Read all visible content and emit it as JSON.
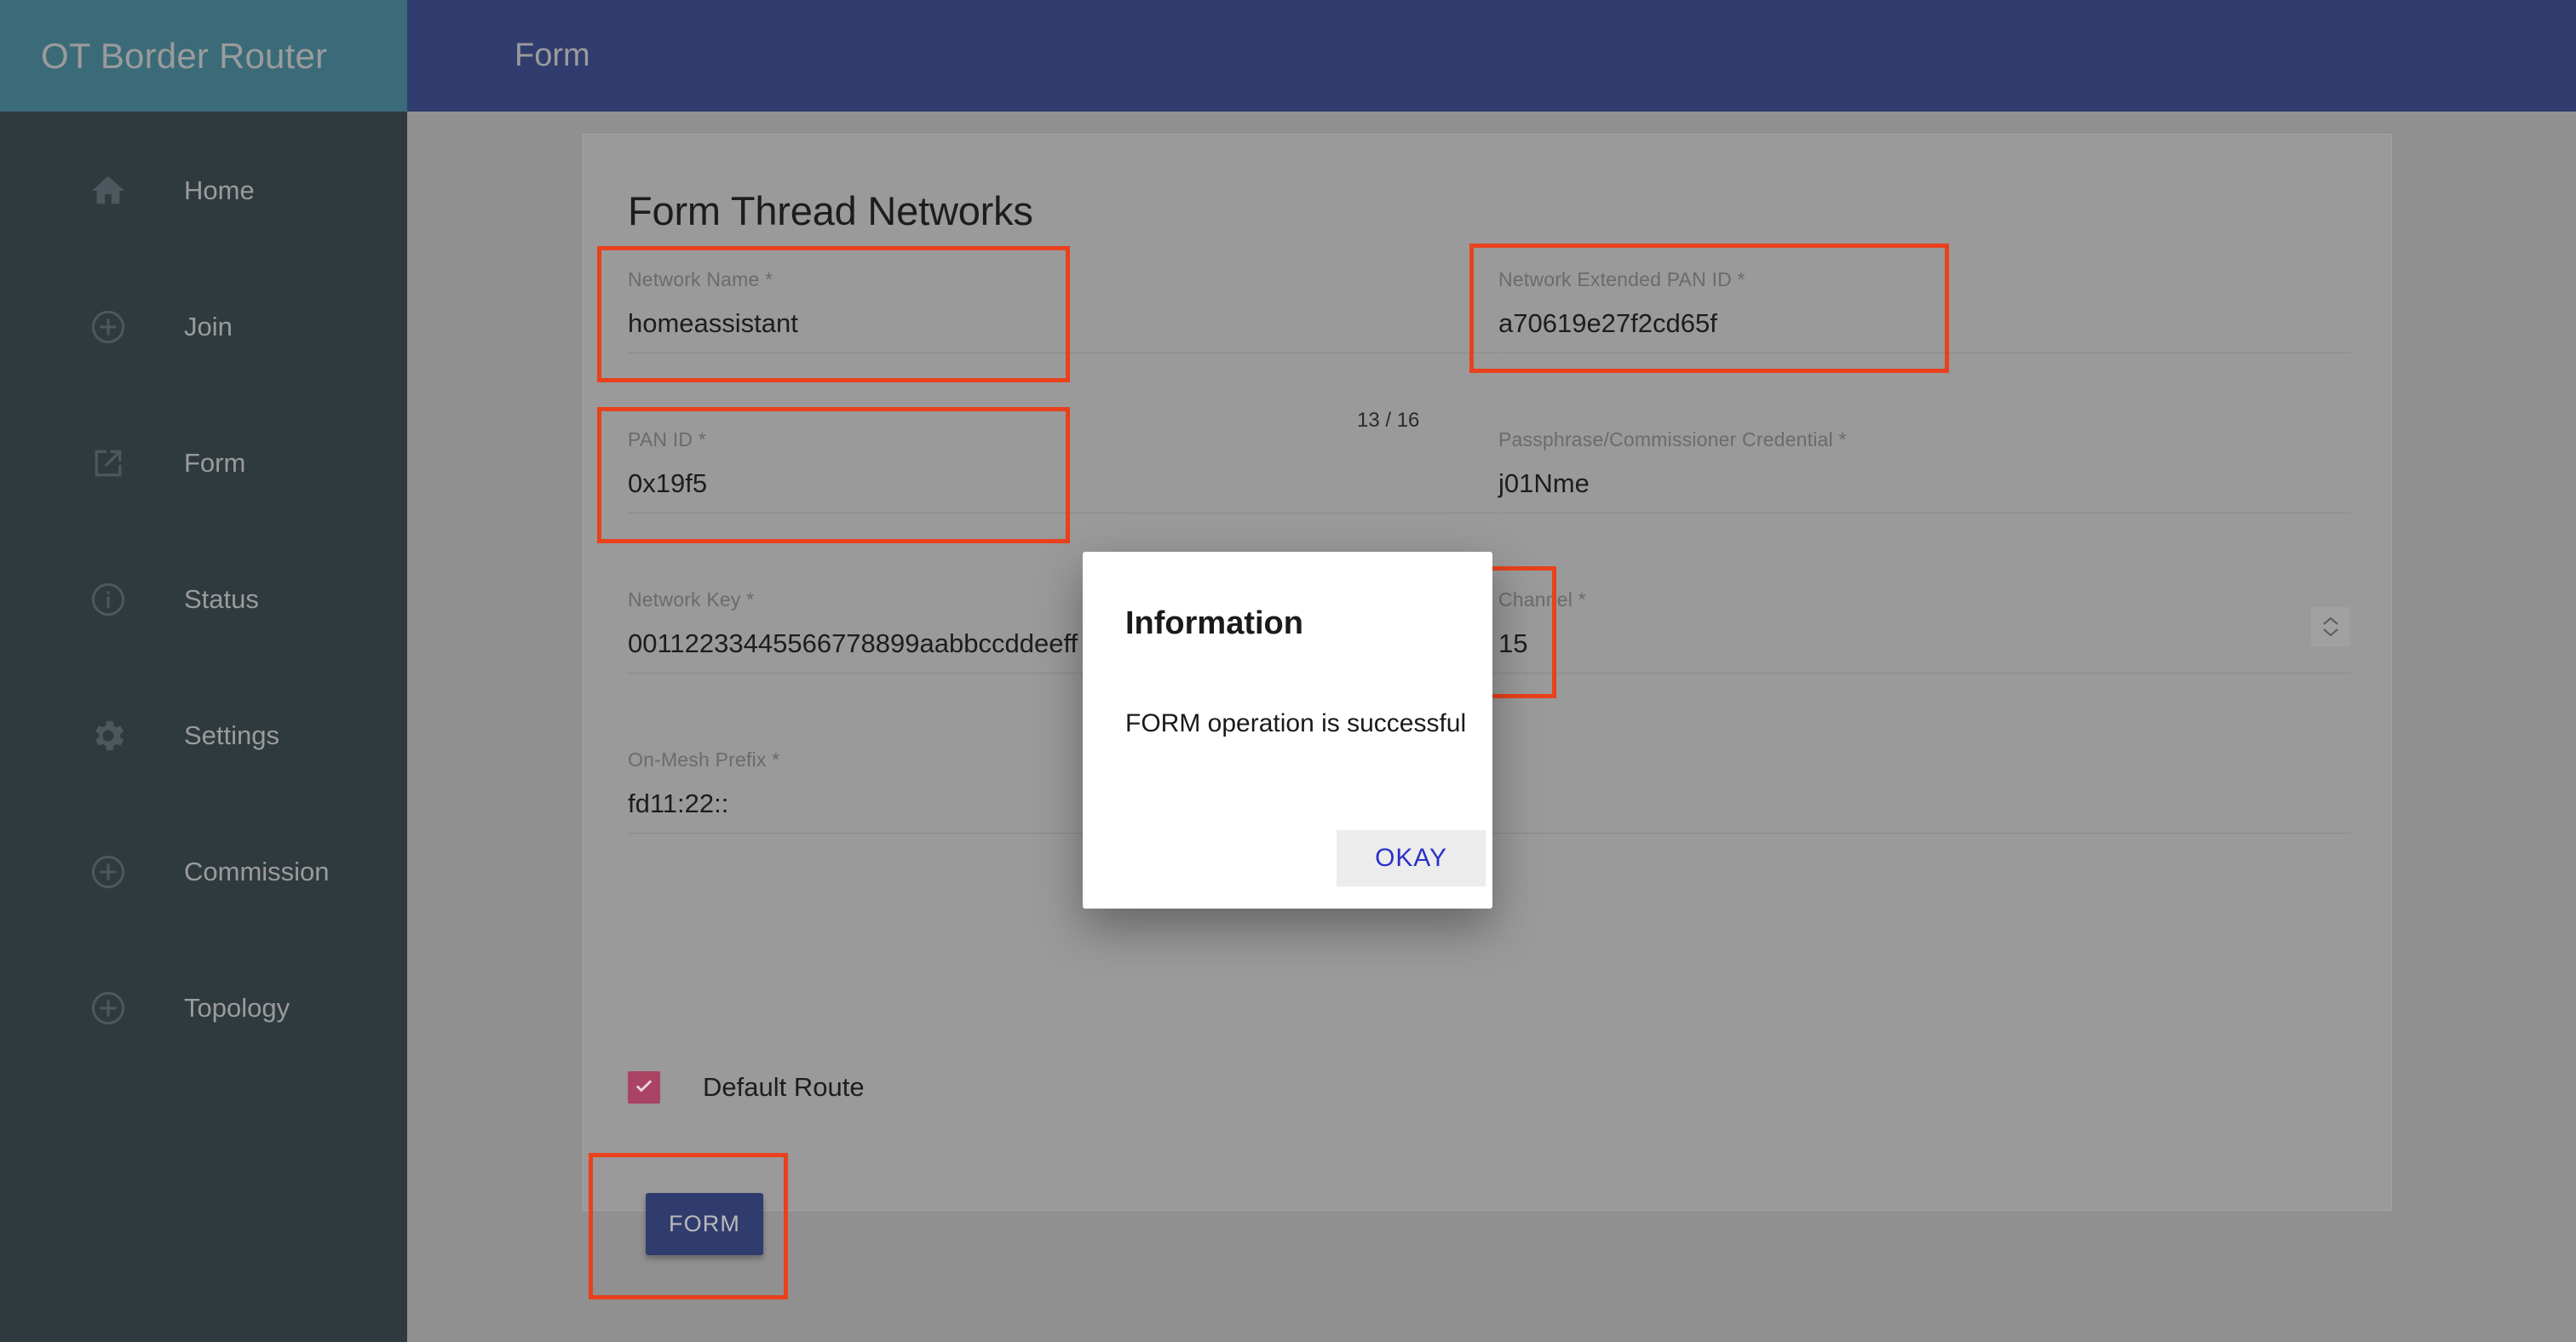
{
  "sidebar": {
    "brand": "OT Border Router",
    "items": [
      {
        "label": "Home",
        "icon": "home-icon"
      },
      {
        "label": "Join",
        "icon": "plus-circle-icon"
      },
      {
        "label": "Form",
        "icon": "open-in-new-icon"
      },
      {
        "label": "Status",
        "icon": "info-circle-icon"
      },
      {
        "label": "Settings",
        "icon": "gear-icon"
      },
      {
        "label": "Commission",
        "icon": "plus-circle-icon"
      },
      {
        "label": "Topology",
        "icon": "plus-circle-icon"
      }
    ]
  },
  "appbar": {
    "title": "Form"
  },
  "page": {
    "title": "Form Thread Networks",
    "fields": [
      {
        "label": "Network Name *",
        "value": "homeassistant"
      },
      {
        "label": "Network Extended PAN ID *",
        "value": "a70619e27f2cd65f",
        "counter": "13 / 16"
      },
      {
        "label": "PAN ID *",
        "value": "0x19f5"
      },
      {
        "label": "Passphrase/Commissioner Credential *",
        "value": "j01Nme"
      },
      {
        "label": "Network Key *",
        "value": "00112233445566778899aabbccddeeff"
      },
      {
        "label": "Channel *",
        "value": "15"
      },
      {
        "label": "On-Mesh Prefix *",
        "value": "fd11:22::"
      }
    ],
    "checkbox": {
      "label": "Default Route",
      "checked": "true"
    },
    "submit_label": "FORM"
  },
  "dialog": {
    "title": "Information",
    "message": "FORM operation is successful",
    "ok_label": "OKAY"
  },
  "colors": {
    "brand_teal": "#3b6b79",
    "appbar_navy": "#313c6e",
    "sidebar_dark": "#2f3a3e",
    "checkbox_pink": "#aa4465",
    "highlight_red": "#e8411c",
    "link_blue": "#2b31c9"
  }
}
